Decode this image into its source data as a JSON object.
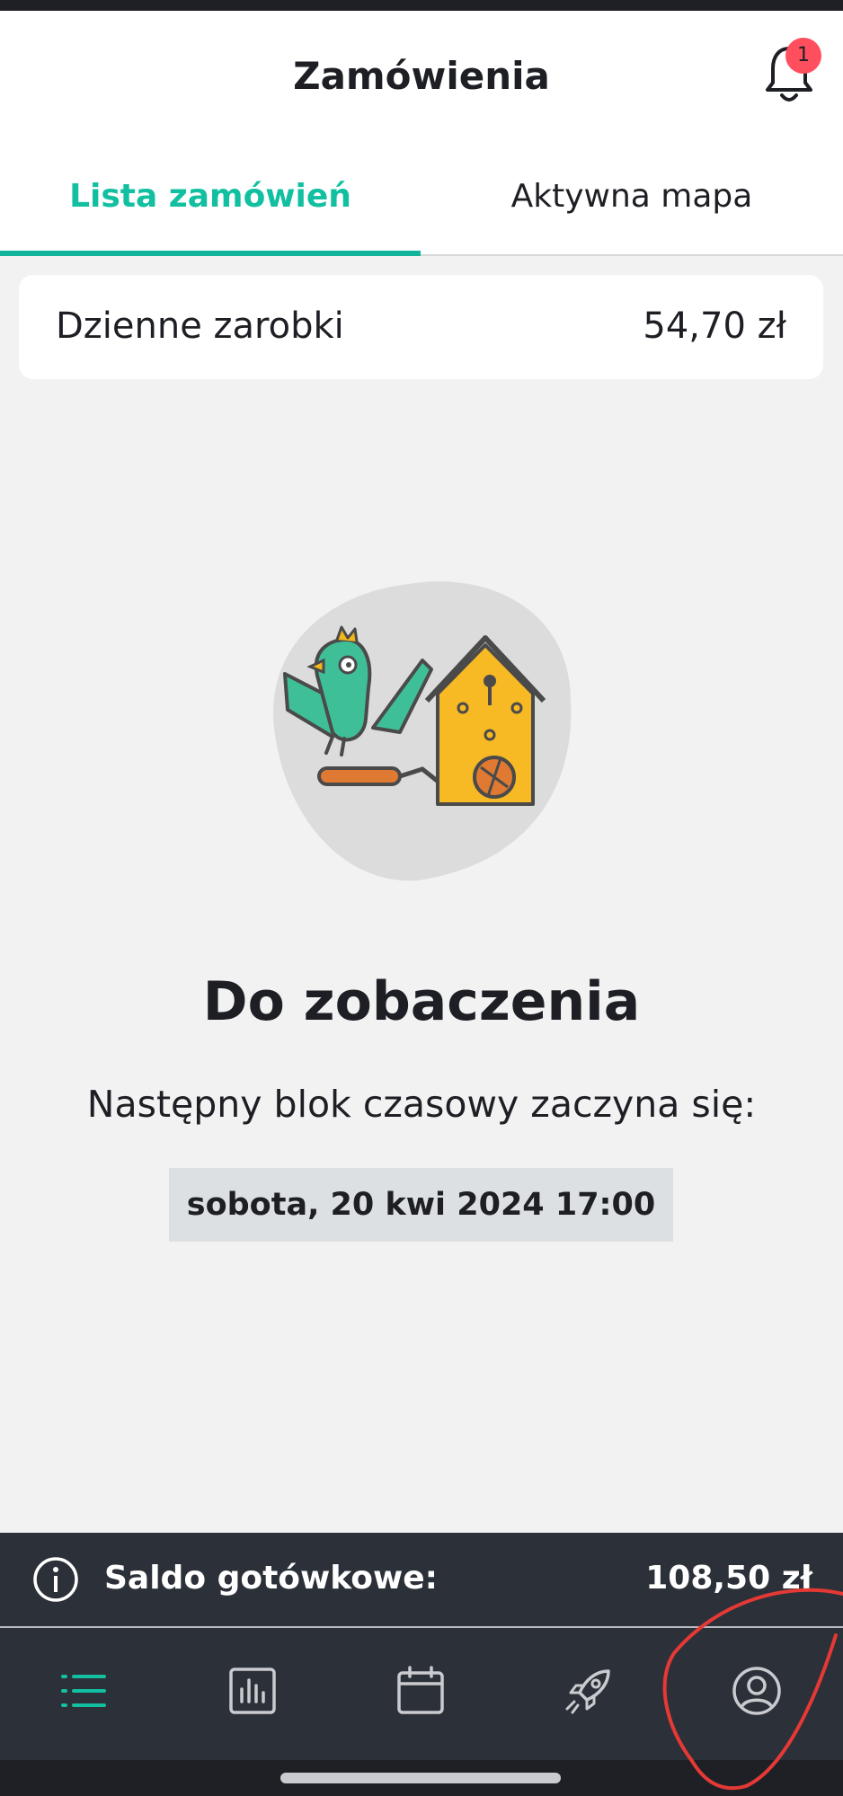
{
  "header": {
    "title": "Zamówienia",
    "notification_count": "1"
  },
  "tabs": [
    {
      "label": "Lista zamówień",
      "active": true
    },
    {
      "label": "Aktywna mapa",
      "active": false
    }
  ],
  "earnings": {
    "label": "Dzienne zarobki",
    "value": "54,70 zł"
  },
  "empty_state": {
    "illustration": "cuckoo-clock-bird-illustration",
    "headline": "Do zobaczenia",
    "subtext": "Następny blok czasowy zaczyna się:",
    "next_slot": "sobota, 20 kwi 2024 17:00"
  },
  "balance": {
    "label": "Saldo gotówkowe:",
    "value": "108,50 zł",
    "icon": "info-icon"
  },
  "bottom_nav": [
    {
      "name": "orders-list",
      "icon": "list-icon",
      "active": true
    },
    {
      "name": "statistics",
      "icon": "bar-chart-icon",
      "active": false
    },
    {
      "name": "calendar",
      "icon": "calendar-icon",
      "active": false
    },
    {
      "name": "boost",
      "icon": "rocket-icon",
      "active": false
    },
    {
      "name": "profile",
      "icon": "user-circle-icon",
      "active": false
    }
  ],
  "colors": {
    "accent": "#12c0a1",
    "badge": "#ff4f5e",
    "dark_bar": "#2c3038",
    "background": "#f2f2f2",
    "annotation": "#e53935"
  }
}
